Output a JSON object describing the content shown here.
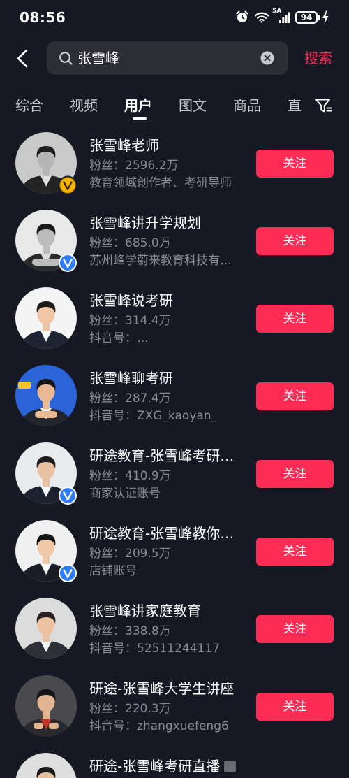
{
  "status_bar": {
    "time": "08:56",
    "network_label": "5A",
    "battery_level": "94",
    "icons": [
      "alarm-icon",
      "wifi-icon",
      "signal-icon",
      "battery-icon",
      "charging-icon"
    ]
  },
  "header": {
    "search_query": "张雪峰",
    "search_button_label": "搜索",
    "icons": [
      "back-arrow-icon",
      "search-icon",
      "clear-icon"
    ]
  },
  "tabs": [
    {
      "label": "综合"
    },
    {
      "label": "视频"
    },
    {
      "label": "用户",
      "selected": true
    },
    {
      "label": "图文"
    },
    {
      "label": "商品"
    },
    {
      "label": "直"
    }
  ],
  "filter_icon": "filter-icon",
  "users": [
    {
      "name": "张雪峰老师",
      "fans": "粉丝：2596.2万",
      "info": "教育领域创作者、考研导师",
      "badge": "gold-verified-badge-icon",
      "follow_label": "关注"
    },
    {
      "name": "张雪峰讲升学规划",
      "fans": "粉丝：685.0万",
      "info": "苏州峰学蔚来教育科技有…",
      "badge": "blue-verified-badge-icon",
      "follow_label": "关注"
    },
    {
      "name": "张雪峰说考研",
      "fans": "粉丝：314.4万",
      "info": "抖音号：…",
      "follow_label": "关注"
    },
    {
      "name": "张雪峰聊考研",
      "fans": "粉丝：287.4万",
      "info": "抖音号：ZXG_kaoyan_",
      "follow_label": "关注"
    },
    {
      "name": "研途教育-张雪峰考研…",
      "fans": "粉丝：410.9万",
      "info": "商家认证账号",
      "badge": "blue-verified-badge-icon",
      "follow_label": "关注"
    },
    {
      "name": "研途教育-张雪峰教你…",
      "fans": "粉丝：209.5万",
      "info": "店铺账号",
      "badge": "blue-verified-badge-icon",
      "follow_label": "关注"
    },
    {
      "name": "张雪峰讲家庭教育",
      "fans": "粉丝：338.8万",
      "info": "抖音号：52511244117",
      "follow_label": "关注"
    },
    {
      "name": "研途-张雪峰大学生讲座",
      "fans": "粉丝：220.3万",
      "info": "抖音号：zhangxuefeng6",
      "follow_label": "关注"
    },
    {
      "name": "研途-张雪峰考研直播",
      "tag_icon": "gray-square-icon"
    }
  ],
  "colors": {
    "background": "#161823",
    "accent": "#fe2c55",
    "secondary_text": "#8a8b91",
    "search_field": "#2c2d35",
    "verified_gold": "#f4b400",
    "verified_blue": "#2f7dff"
  }
}
